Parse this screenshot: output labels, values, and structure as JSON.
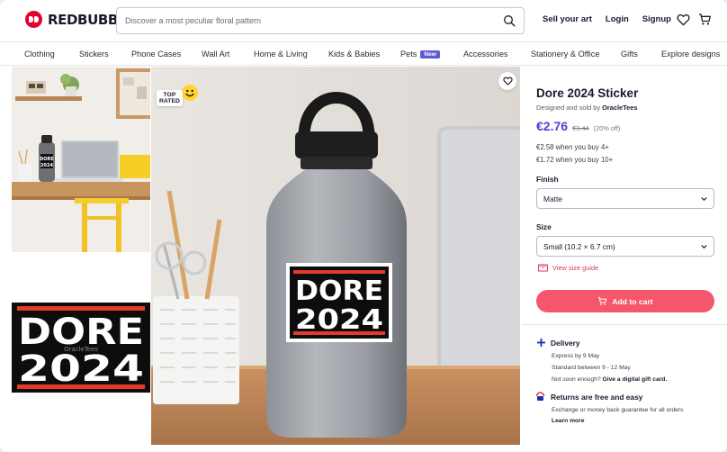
{
  "brand": {
    "name": "REDBUBBLE"
  },
  "search": {
    "placeholder": "Discover a most peculiar floral pattern"
  },
  "header": {
    "sell": "Sell your art",
    "login": "Login",
    "signup": "Signup"
  },
  "nav": {
    "items": [
      "Clothing",
      "Stickers",
      "Phone Cases",
      "Wall Art",
      "Home & Living",
      "Kids & Babies",
      "Pets",
      "Accessories",
      "Stationery & Office",
      "Gifts",
      "Explore designs"
    ],
    "new_badge": "New"
  },
  "gallery": {
    "top_rated": "TOP\nRATED",
    "sticker_line1": "DORE",
    "sticker_line2": "2024",
    "watermark": "OracleTees"
  },
  "product": {
    "title": "Dore 2024 Sticker",
    "designed_by": "Designed and sold by ",
    "designer": "OracleTees",
    "price": "€2.76",
    "price_old": "€3.44",
    "price_off": "(20% off)",
    "bulk_4": "€2.58 when you buy 4+",
    "bulk_10": "€1.72 when you buy 10+",
    "finish_label": "Finish",
    "finish_value": "Matte",
    "size_label": "Size",
    "size_value": "Small (10.2 × 6.7 cm)",
    "size_guide": "View size guide",
    "add_to_cart": "Add to cart"
  },
  "delivery": {
    "title": "Delivery",
    "express": "Express by 9 May",
    "standard": "Standard between 9 - 12 May",
    "not_soon": "Not soon enough? ",
    "gift_card": "Give a digital gift card.",
    "returns_title": "Returns are free and easy",
    "returns_text": "Exchange or money back guarantee for all orders",
    "learn_more": "Learn more"
  },
  "colors": {
    "accent": "#4b3fd1",
    "cart": "#f5566b",
    "brand_red": "#e4002b",
    "badge": "#5c5cd6"
  }
}
